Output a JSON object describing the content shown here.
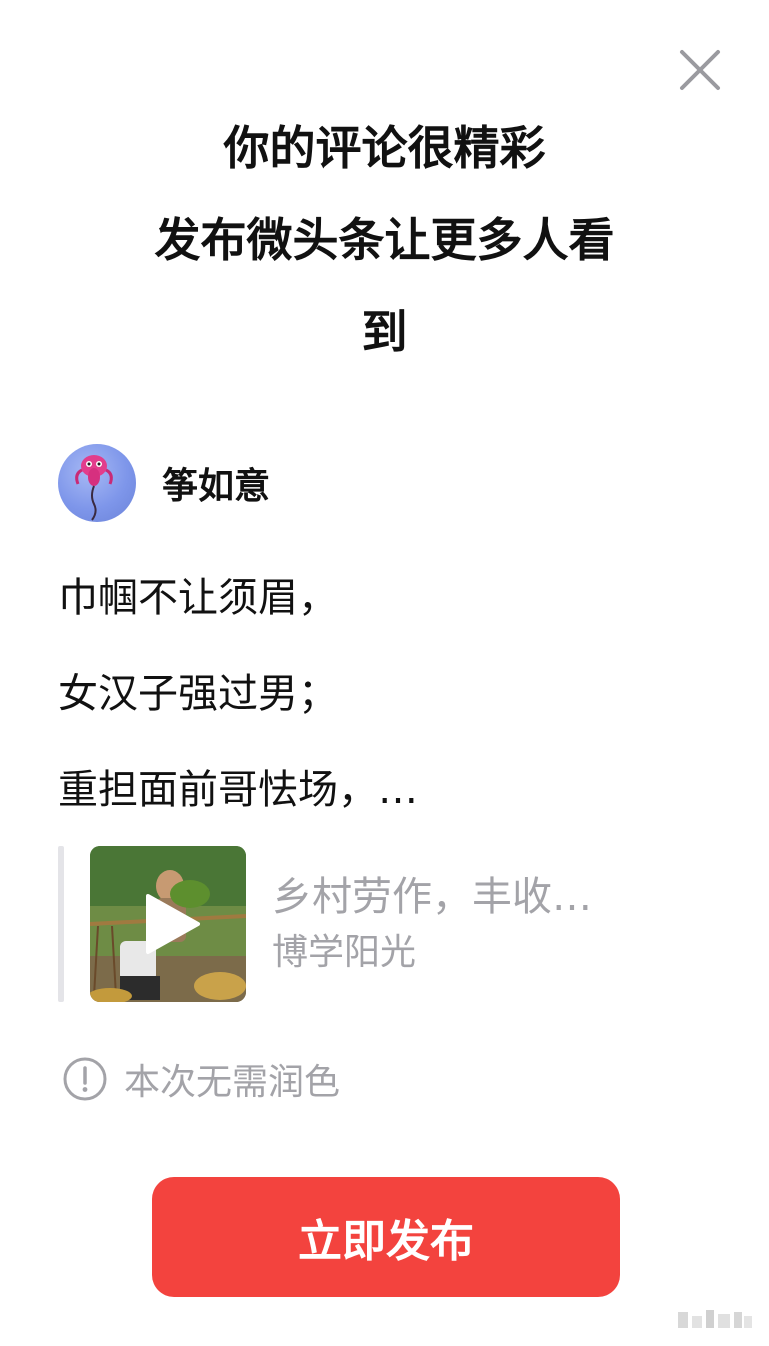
{
  "header": {
    "title_lines": [
      "你的评论很精彩",
      "发布微头条让更多人看",
      "到"
    ]
  },
  "author": {
    "name": "筝如意",
    "avatar_color": "#7e96ea"
  },
  "comment": {
    "lines": [
      "巾帼不让须眉，",
      "女汉子强过男；",
      "重担面前哥怯场，…"
    ]
  },
  "quoted_post": {
    "title": "乡村劳作，丰收…",
    "author": "博学阳光",
    "thumbnail_icon": "play-icon"
  },
  "notice": {
    "icon": "info-circle-icon",
    "text": "本次无需润色"
  },
  "actions": {
    "publish_label": "立即发布",
    "publish_color": "#f3433e",
    "close_icon": "close-icon"
  }
}
